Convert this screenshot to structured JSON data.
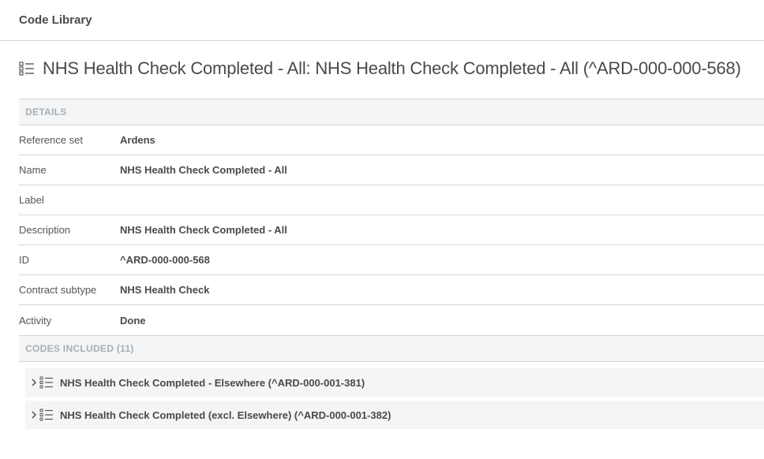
{
  "topbar": {
    "title": "Code Library"
  },
  "heading": {
    "title": "NHS Health Check Completed - All: NHS Health Check Completed - All (^ARD-000-000-568)"
  },
  "details": {
    "header": "DETAILS",
    "rows": [
      {
        "label": "Reference set",
        "value": "Ardens"
      },
      {
        "label": "Name",
        "value": "NHS Health Check Completed - All"
      },
      {
        "label": "Label",
        "value": ""
      },
      {
        "label": "Description",
        "value": "NHS Health Check Completed - All"
      },
      {
        "label": "ID",
        "value": "^ARD-000-000-568"
      },
      {
        "label": "Contract subtype",
        "value": "NHS Health Check"
      },
      {
        "label": "Activity",
        "value": "Done"
      }
    ]
  },
  "codes": {
    "header": "CODES INCLUDED (11)",
    "items": [
      {
        "label": "NHS Health Check Completed - Elsewhere (^ARD-000-001-381)",
        "icon": "chevron-right-icon"
      },
      {
        "label": "NHS Health Check Completed (excl. Elsewhere) (^ARD-000-001-382)",
        "icon": "chevron-right-icon"
      }
    ]
  },
  "colors": {
    "text": "#4a4a4a",
    "section_bg": "#f3f5f6",
    "muted_header": "#a9aeb2",
    "border": "#d6d6d6"
  }
}
